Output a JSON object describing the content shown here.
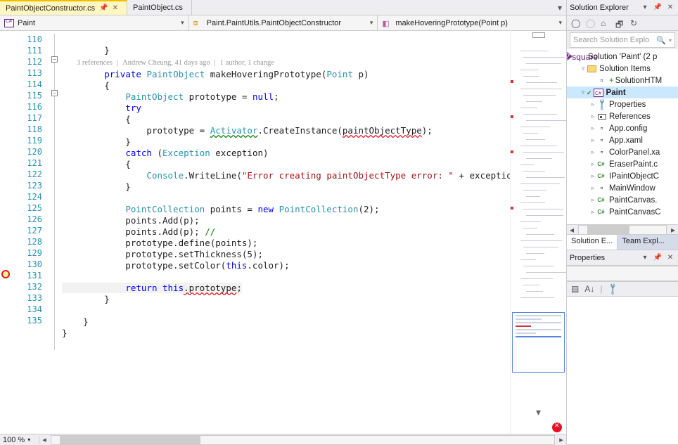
{
  "tabs": {
    "active": "PaintObjectConstructor.cs",
    "inactive": "PaintObject.cs"
  },
  "nav": {
    "namespace": "Paint",
    "class": "Paint.PaintUtils.PaintObjectConstructor",
    "method": "makeHoveringPrototype(Point p)"
  },
  "codelens": {
    "refs": "3 references",
    "author": "Andrew Cheung, 41 days ago",
    "changes": "1 author, 1 change"
  },
  "lines": {
    "start": 110,
    "end": 135
  },
  "code": {
    "l110": "        }",
    "l112": "        {",
    "l114_2": "try",
    "l115": "            {",
    "l117": "            }",
    "l119": "            {",
    "l121": "            }",
    "l124": "            points.Add(p);",
    "l126": "            prototype.define(points);",
    "l129": "",
    "l131": "        }",
    "l132": "",
    "l133": "    }",
    "l134": "}",
    "l135": ""
  },
  "tokens": {
    "private": "private",
    "PaintObject": "PaintObject",
    "methodName": "makeHoveringPrototype",
    "Point": "Point",
    "paramP": "p",
    "prototype": "prototype",
    "nullk": "null",
    "Activator": "Activator",
    "CreateInstance": ".CreateInstance(",
    "paintObjectType": "paintObjectType",
    "catch": "catch",
    "Exception": "Exception",
    "exception": "exception",
    "Console": "Console",
    "WriteLine": ".WriteLine(",
    "errStr": "\"Error creating paintObjectType error: \"",
    "plusExc": " + exception.Me",
    "PointCollection": "PointCollection",
    "points": "points",
    "new": "new",
    "two": "2",
    "addComment": "            points.Add(p);",
    "commentSlash": " //",
    "setThickness": "            prototype.setThickness(",
    "five": "5",
    "setColor": "            prototype.setColor(",
    "thisk": "this",
    "dotColor": ".color);",
    "return": "return",
    "thisProto": ".prototype",
    "semi": ";"
  },
  "zoom": "100 %",
  "solutionExplorer": {
    "title": "Solution Explorer",
    "search": "Search Solution Explo",
    "solution": "Solution 'Paint' (2 p",
    "items": [
      {
        "label": "Solution Items",
        "indent": 1,
        "icon": "folder",
        "exp": "▿"
      },
      {
        "label": "SolutionHTM",
        "indent": 2,
        "icon": "file",
        "prefix": "+"
      },
      {
        "label": "Paint",
        "indent": 1,
        "icon": "cs",
        "exp": "▿",
        "bold": true,
        "sel": true,
        "check": true
      },
      {
        "label": "Properties",
        "indent": 2,
        "icon": "prop",
        "exp": "▹"
      },
      {
        "label": "References",
        "indent": 2,
        "icon": "ref",
        "exp": "▹"
      },
      {
        "label": "App.config",
        "indent": 2,
        "icon": "cfg",
        "exp": "▹"
      },
      {
        "label": "App.xaml",
        "indent": 2,
        "icon": "cfg",
        "exp": "▹"
      },
      {
        "label": "ColorPanel.xa",
        "indent": 2,
        "icon": "cfg",
        "exp": "▹"
      },
      {
        "label": "EraserPaint.c",
        "indent": 2,
        "icon": "csf",
        "exp": "▹"
      },
      {
        "label": "IPaintObjectC",
        "indent": 2,
        "icon": "csf",
        "exp": "▹"
      },
      {
        "label": "MainWindow",
        "indent": 2,
        "icon": "cfg",
        "exp": "▹"
      },
      {
        "label": "PaintCanvas.",
        "indent": 2,
        "icon": "csf",
        "exp": "▹"
      },
      {
        "label": "PaintCanvasC",
        "indent": 2,
        "icon": "csf",
        "exp": "▹"
      }
    ],
    "tabsBottom": {
      "a": "Solution E...",
      "b": "Team Expl..."
    }
  },
  "properties": {
    "title": "Properties"
  }
}
